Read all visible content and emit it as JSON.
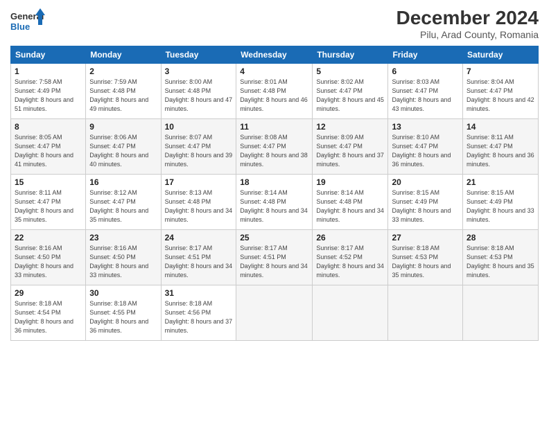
{
  "header": {
    "logo_general": "General",
    "logo_blue": "Blue",
    "month": "December 2024",
    "location": "Pilu, Arad County, Romania"
  },
  "days_of_week": [
    "Sunday",
    "Monday",
    "Tuesday",
    "Wednesday",
    "Thursday",
    "Friday",
    "Saturday"
  ],
  "weeks": [
    [
      {
        "day": 1,
        "sunrise": "7:58 AM",
        "sunset": "4:49 PM",
        "daylight": "8 hours and 51 minutes."
      },
      {
        "day": 2,
        "sunrise": "7:59 AM",
        "sunset": "4:48 PM",
        "daylight": "8 hours and 49 minutes."
      },
      {
        "day": 3,
        "sunrise": "8:00 AM",
        "sunset": "4:48 PM",
        "daylight": "8 hours and 47 minutes."
      },
      {
        "day": 4,
        "sunrise": "8:01 AM",
        "sunset": "4:48 PM",
        "daylight": "8 hours and 46 minutes."
      },
      {
        "day": 5,
        "sunrise": "8:02 AM",
        "sunset": "4:47 PM",
        "daylight": "8 hours and 45 minutes."
      },
      {
        "day": 6,
        "sunrise": "8:03 AM",
        "sunset": "4:47 PM",
        "daylight": "8 hours and 43 minutes."
      },
      {
        "day": 7,
        "sunrise": "8:04 AM",
        "sunset": "4:47 PM",
        "daylight": "8 hours and 42 minutes."
      }
    ],
    [
      {
        "day": 8,
        "sunrise": "8:05 AM",
        "sunset": "4:47 PM",
        "daylight": "8 hours and 41 minutes."
      },
      {
        "day": 9,
        "sunrise": "8:06 AM",
        "sunset": "4:47 PM",
        "daylight": "8 hours and 40 minutes."
      },
      {
        "day": 10,
        "sunrise": "8:07 AM",
        "sunset": "4:47 PM",
        "daylight": "8 hours and 39 minutes."
      },
      {
        "day": 11,
        "sunrise": "8:08 AM",
        "sunset": "4:47 PM",
        "daylight": "8 hours and 38 minutes."
      },
      {
        "day": 12,
        "sunrise": "8:09 AM",
        "sunset": "4:47 PM",
        "daylight": "8 hours and 37 minutes."
      },
      {
        "day": 13,
        "sunrise": "8:10 AM",
        "sunset": "4:47 PM",
        "daylight": "8 hours and 36 minutes."
      },
      {
        "day": 14,
        "sunrise": "8:11 AM",
        "sunset": "4:47 PM",
        "daylight": "8 hours and 36 minutes."
      }
    ],
    [
      {
        "day": 15,
        "sunrise": "8:11 AM",
        "sunset": "4:47 PM",
        "daylight": "8 hours and 35 minutes."
      },
      {
        "day": 16,
        "sunrise": "8:12 AM",
        "sunset": "4:47 PM",
        "daylight": "8 hours and 35 minutes."
      },
      {
        "day": 17,
        "sunrise": "8:13 AM",
        "sunset": "4:48 PM",
        "daylight": "8 hours and 34 minutes."
      },
      {
        "day": 18,
        "sunrise": "8:14 AM",
        "sunset": "4:48 PM",
        "daylight": "8 hours and 34 minutes."
      },
      {
        "day": 19,
        "sunrise": "8:14 AM",
        "sunset": "4:48 PM",
        "daylight": "8 hours and 34 minutes."
      },
      {
        "day": 20,
        "sunrise": "8:15 AM",
        "sunset": "4:49 PM",
        "daylight": "8 hours and 33 minutes."
      },
      {
        "day": 21,
        "sunrise": "8:15 AM",
        "sunset": "4:49 PM",
        "daylight": "8 hours and 33 minutes."
      }
    ],
    [
      {
        "day": 22,
        "sunrise": "8:16 AM",
        "sunset": "4:50 PM",
        "daylight": "8 hours and 33 minutes."
      },
      {
        "day": 23,
        "sunrise": "8:16 AM",
        "sunset": "4:50 PM",
        "daylight": "8 hours and 33 minutes."
      },
      {
        "day": 24,
        "sunrise": "8:17 AM",
        "sunset": "4:51 PM",
        "daylight": "8 hours and 34 minutes."
      },
      {
        "day": 25,
        "sunrise": "8:17 AM",
        "sunset": "4:51 PM",
        "daylight": "8 hours and 34 minutes."
      },
      {
        "day": 26,
        "sunrise": "8:17 AM",
        "sunset": "4:52 PM",
        "daylight": "8 hours and 34 minutes."
      },
      {
        "day": 27,
        "sunrise": "8:18 AM",
        "sunset": "4:53 PM",
        "daylight": "8 hours and 35 minutes."
      },
      {
        "day": 28,
        "sunrise": "8:18 AM",
        "sunset": "4:53 PM",
        "daylight": "8 hours and 35 minutes."
      }
    ],
    [
      {
        "day": 29,
        "sunrise": "8:18 AM",
        "sunset": "4:54 PM",
        "daylight": "8 hours and 36 minutes."
      },
      {
        "day": 30,
        "sunrise": "8:18 AM",
        "sunset": "4:55 PM",
        "daylight": "8 hours and 36 minutes."
      },
      {
        "day": 31,
        "sunrise": "8:18 AM",
        "sunset": "4:56 PM",
        "daylight": "8 hours and 37 minutes."
      },
      null,
      null,
      null,
      null
    ]
  ]
}
